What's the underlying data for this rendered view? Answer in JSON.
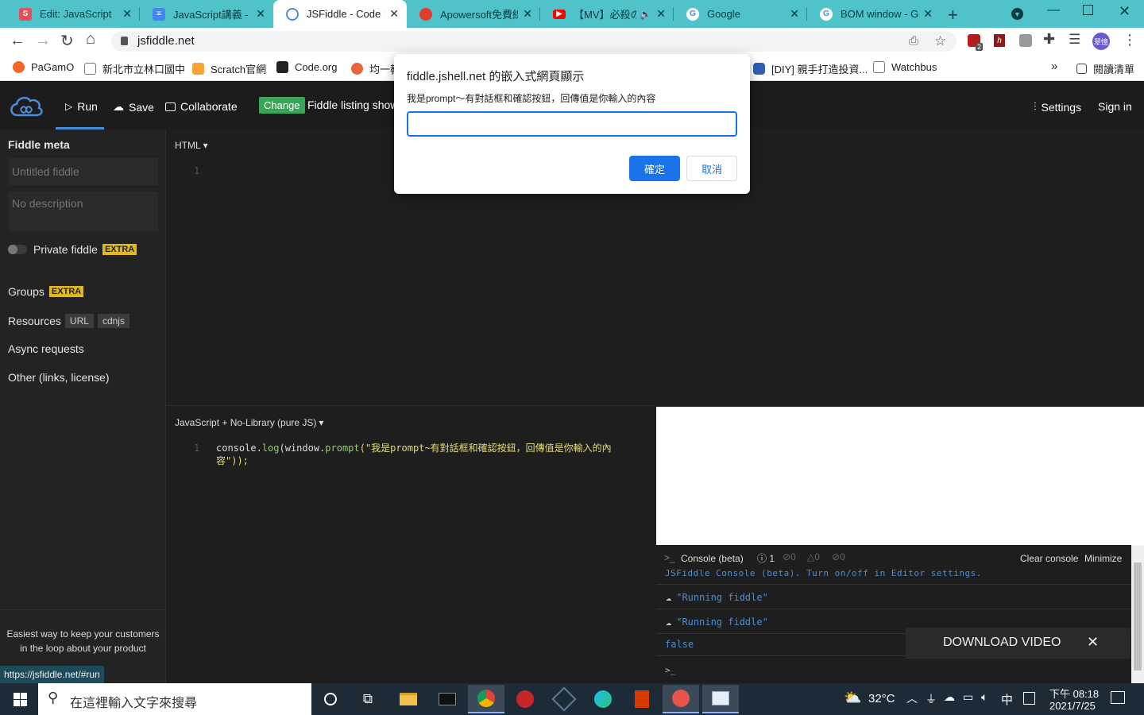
{
  "browser": {
    "tabs": [
      {
        "title": "Edit: JavaScript",
        "favicon": "s-icon",
        "color": "#e94d5b"
      },
      {
        "title": "JavaScript講義 - Go",
        "favicon": "docs-icon",
        "color": "#4285f4"
      },
      {
        "title": "JSFiddle - Code Pl",
        "favicon": "jsfiddle-icon",
        "color": "#4b8dd8"
      },
      {
        "title": "Apowersoft免費線",
        "favicon": "apowersoft-icon",
        "color": "#e33b2e"
      },
      {
        "title": "【MV】必殺の",
        "favicon": "youtube-icon",
        "color": "#ff0000"
      },
      {
        "title": "Google",
        "favicon": "google-icon",
        "color": "#4285f4"
      },
      {
        "title": "BOM window - Go",
        "favicon": "google-icon",
        "color": "#4285f4"
      }
    ],
    "url": "jsfiddle.net",
    "profile_label": "翠憶",
    "ext_badge": "2",
    "bookmarks": [
      "PaGamO",
      "新北市立林口國中",
      "Scratch官網",
      "Code.org",
      "均一教",
      "[DIY] 親手打造投資...",
      "Watchbus"
    ],
    "more_bookmarks": "»",
    "reading_list": "閱讀清單"
  },
  "jsfiddle": {
    "run": "Run",
    "save": "Save",
    "collaborate": "Collaborate",
    "change": "Change",
    "listing": "Fiddle listing shows",
    "settings": "Settings",
    "sign_in": "Sign in",
    "sidebar": {
      "meta_title": "Fiddle meta",
      "title_placeholder": "Untitled fiddle",
      "desc_placeholder": "No description",
      "private": "Private fiddle",
      "extra": "EXTRA",
      "groups": "Groups",
      "resources": "Resources",
      "url_tag": "URL",
      "cdnjs_tag": "cdnjs",
      "async": "Async requests",
      "other": "Other (links, license)",
      "ad_text": "Easiest way to keep your customers in the loop about your product"
    },
    "html_label": "HTML",
    "html_line": "1",
    "js_label": "JavaScript + No-Library (pure JS)",
    "js_line": "1",
    "js_code_a": "console.",
    "js_code_fn": "log",
    "js_code_b": "(window.",
    "js_code_prompt": "prompt",
    "js_code_str": "(\"我是prompt~有對話框和確認按鈕，回傳值是你輸入的內",
    "js_code_str2": "容\"));",
    "console": {
      "title": "Console (beta)",
      "info_count": "1",
      "log_count": "0",
      "warn_count": "0",
      "error_count": "0",
      "clear": "Clear console",
      "minimize": "Minimize",
      "note": "JSFiddle Console (beta). Turn on/off in Editor settings.",
      "line1": "\"Running fiddle\"",
      "line2": "\"Running fiddle\"",
      "result": "false",
      "prompt": ">_"
    },
    "download_video": "DOWNLOAD VIDEO",
    "status_url": "https://jsfiddle.net/#run"
  },
  "dialog": {
    "origin": "fiddle.jshell.net 的嵌入式網頁顯示",
    "message": "我是prompt～有對話框和確認按鈕，回傳值是你輸入的內容",
    "input_value": "",
    "ok": "確定",
    "cancel": "取消"
  },
  "taskbar": {
    "search_placeholder": "在這裡輸入文字來搜尋",
    "weather": "32°C",
    "ime": "中",
    "time": "下午 08:18",
    "date": "2021/7/25"
  }
}
